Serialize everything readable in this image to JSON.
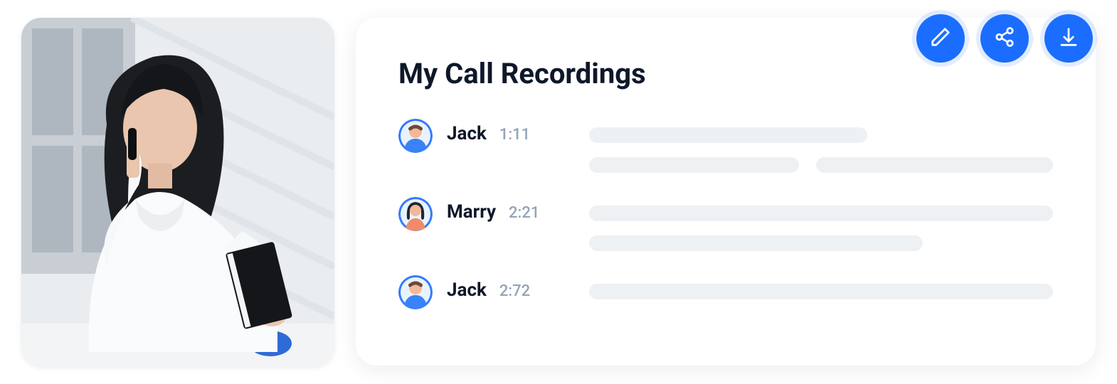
{
  "panel": {
    "title": "My Call Recordings"
  },
  "recordings": [
    {
      "name": "Jack",
      "time": "1:11",
      "avatar": "male"
    },
    {
      "name": "Marry",
      "time": "2:21",
      "avatar": "female"
    },
    {
      "name": "Jack",
      "time": "2:72",
      "avatar": "male"
    }
  ],
  "actions": {
    "edit": "edit",
    "share": "share",
    "download": "download"
  }
}
